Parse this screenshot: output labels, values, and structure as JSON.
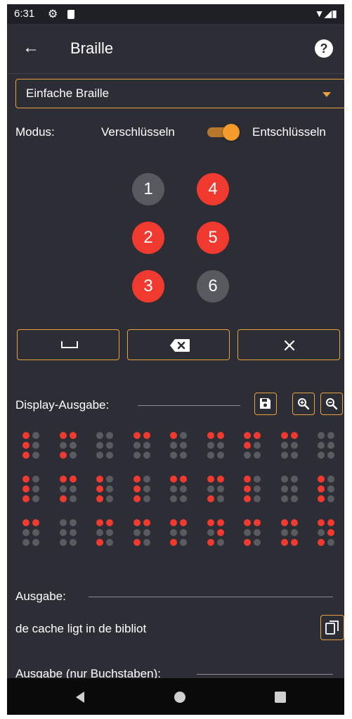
{
  "status_bar": {
    "time": "6:31"
  },
  "app_bar": {
    "title": "Braille"
  },
  "dropdown": {
    "selected": "Einfache Braille"
  },
  "mode": {
    "label": "Modus:",
    "encrypt": "Verschlüsseln",
    "decrypt": "Entschlüsseln",
    "decrypt_active": true
  },
  "dot_buttons": [
    {
      "label": "1",
      "active": false
    },
    {
      "label": "2",
      "active": true
    },
    {
      "label": "3",
      "active": true
    },
    {
      "label": "4",
      "active": true
    },
    {
      "label": "5",
      "active": true
    },
    {
      "label": "6",
      "active": false
    }
  ],
  "display_output": {
    "label": "Display-Ausgabe:"
  },
  "braille_cells": [
    [
      [
        1,
        1,
        1,
        0,
        0,
        0
      ],
      [
        1,
        0,
        1,
        1,
        0,
        0
      ],
      [
        0,
        0,
        0,
        0,
        0,
        0
      ],
      [
        1,
        0,
        0,
        1,
        0,
        0
      ],
      [
        1,
        0,
        0,
        0,
        0,
        0
      ],
      [
        1,
        0,
        0,
        1,
        0,
        0
      ],
      [
        1,
        1,
        0,
        1,
        0,
        0
      ],
      [
        1,
        0,
        0,
        1,
        0,
        0
      ],
      [
        0,
        0,
        0,
        0,
        0,
        0
      ]
    ],
    [
      [
        1,
        1,
        1,
        0,
        0,
        0
      ],
      [
        1,
        0,
        1,
        1,
        0,
        0
      ],
      [
        1,
        1,
        1,
        0,
        0,
        0
      ],
      [
        1,
        1,
        1,
        0,
        0,
        0
      ],
      [
        1,
        0,
        0,
        1,
        0,
        0
      ],
      [
        1,
        0,
        1,
        1,
        0,
        0
      ],
      [
        1,
        1,
        1,
        0,
        0,
        0
      ],
      [
        0,
        0,
        0,
        0,
        0,
        0
      ],
      [
        1,
        1,
        1,
        0,
        0,
        0
      ]
    ],
    [
      [
        1,
        0,
        0,
        1,
        0,
        0
      ],
      [
        0,
        0,
        0,
        0,
        0,
        0
      ],
      [
        1,
        0,
        1,
        1,
        0,
        0
      ],
      [
        1,
        0,
        1,
        1,
        0,
        0
      ],
      [
        1,
        0,
        1,
        1,
        0,
        0
      ],
      [
        1,
        0,
        1,
        1,
        1,
        0
      ],
      [
        1,
        0,
        1,
        1,
        0,
        0
      ],
      [
        1,
        0,
        1,
        1,
        0,
        1
      ],
      [
        1,
        0,
        1,
        1,
        1,
        0
      ]
    ]
  ],
  "output": {
    "label": "Ausgabe:",
    "text": "de cache ligt in de bibliot"
  },
  "output_letters": {
    "label": "Ausgabe (nur Buchstaben):"
  }
}
